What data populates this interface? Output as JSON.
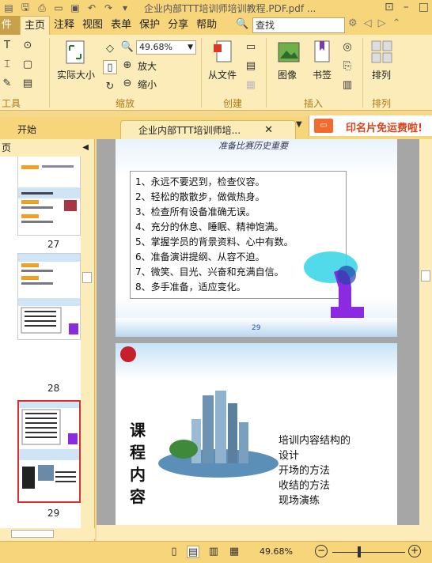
{
  "window": {
    "title": "企业内部TTT培训师培训教程.PDF.pdf ..."
  },
  "ribbon": {
    "file_tab": "件",
    "tabs": [
      "主页",
      "注释",
      "视图",
      "表单",
      "保护",
      "分享",
      "帮助"
    ],
    "active_tab": "主页",
    "search_placeholder": "查找",
    "groups": {
      "tools_label": "工具",
      "zoom_label": "缩放",
      "create_label": "创建",
      "insert_label": "插入",
      "arrange_label": "排列"
    },
    "actual_size": "实际大小",
    "zoom_value": "49.68%",
    "zoom_in": "放大",
    "zoom_out": "缩小",
    "from_file": "从文件",
    "image": "图像",
    "bookmark": "书签",
    "arrange": "排列"
  },
  "doc_tabs": {
    "start": "开始",
    "current": "企业内部TTT培训师培...",
    "ad_text": "印名片免运费啦!"
  },
  "left_panel": {
    "title": "页",
    "thumbnails": [
      {
        "page": "27"
      },
      {
        "page": "28"
      },
      {
        "page": "29"
      }
    ]
  },
  "page1": {
    "heading": "准备比赛历史重要",
    "lines": [
      "1、永远不要迟到，检查仪容。",
      "2、轻松的散散步，做做热身。",
      "3、检查所有设备准确无误。",
      "4、充分的休息、睡眠、精神饱满。",
      "5、掌握学员的背景资料、心中有数。",
      "6、准备演讲提纲、从容不迫。",
      "7、微笑、目光、兴奋和充满自信。",
      "8、多手准备，适应变化。"
    ],
    "page_number": "29"
  },
  "page2": {
    "vertical_title": [
      "课",
      "程",
      "内",
      "容"
    ],
    "items": [
      "培训内容结构的",
      "设计",
      "开场的方法",
      "收结的方法",
      "现场演练"
    ]
  },
  "status": {
    "zoom_label": "49.68%"
  }
}
